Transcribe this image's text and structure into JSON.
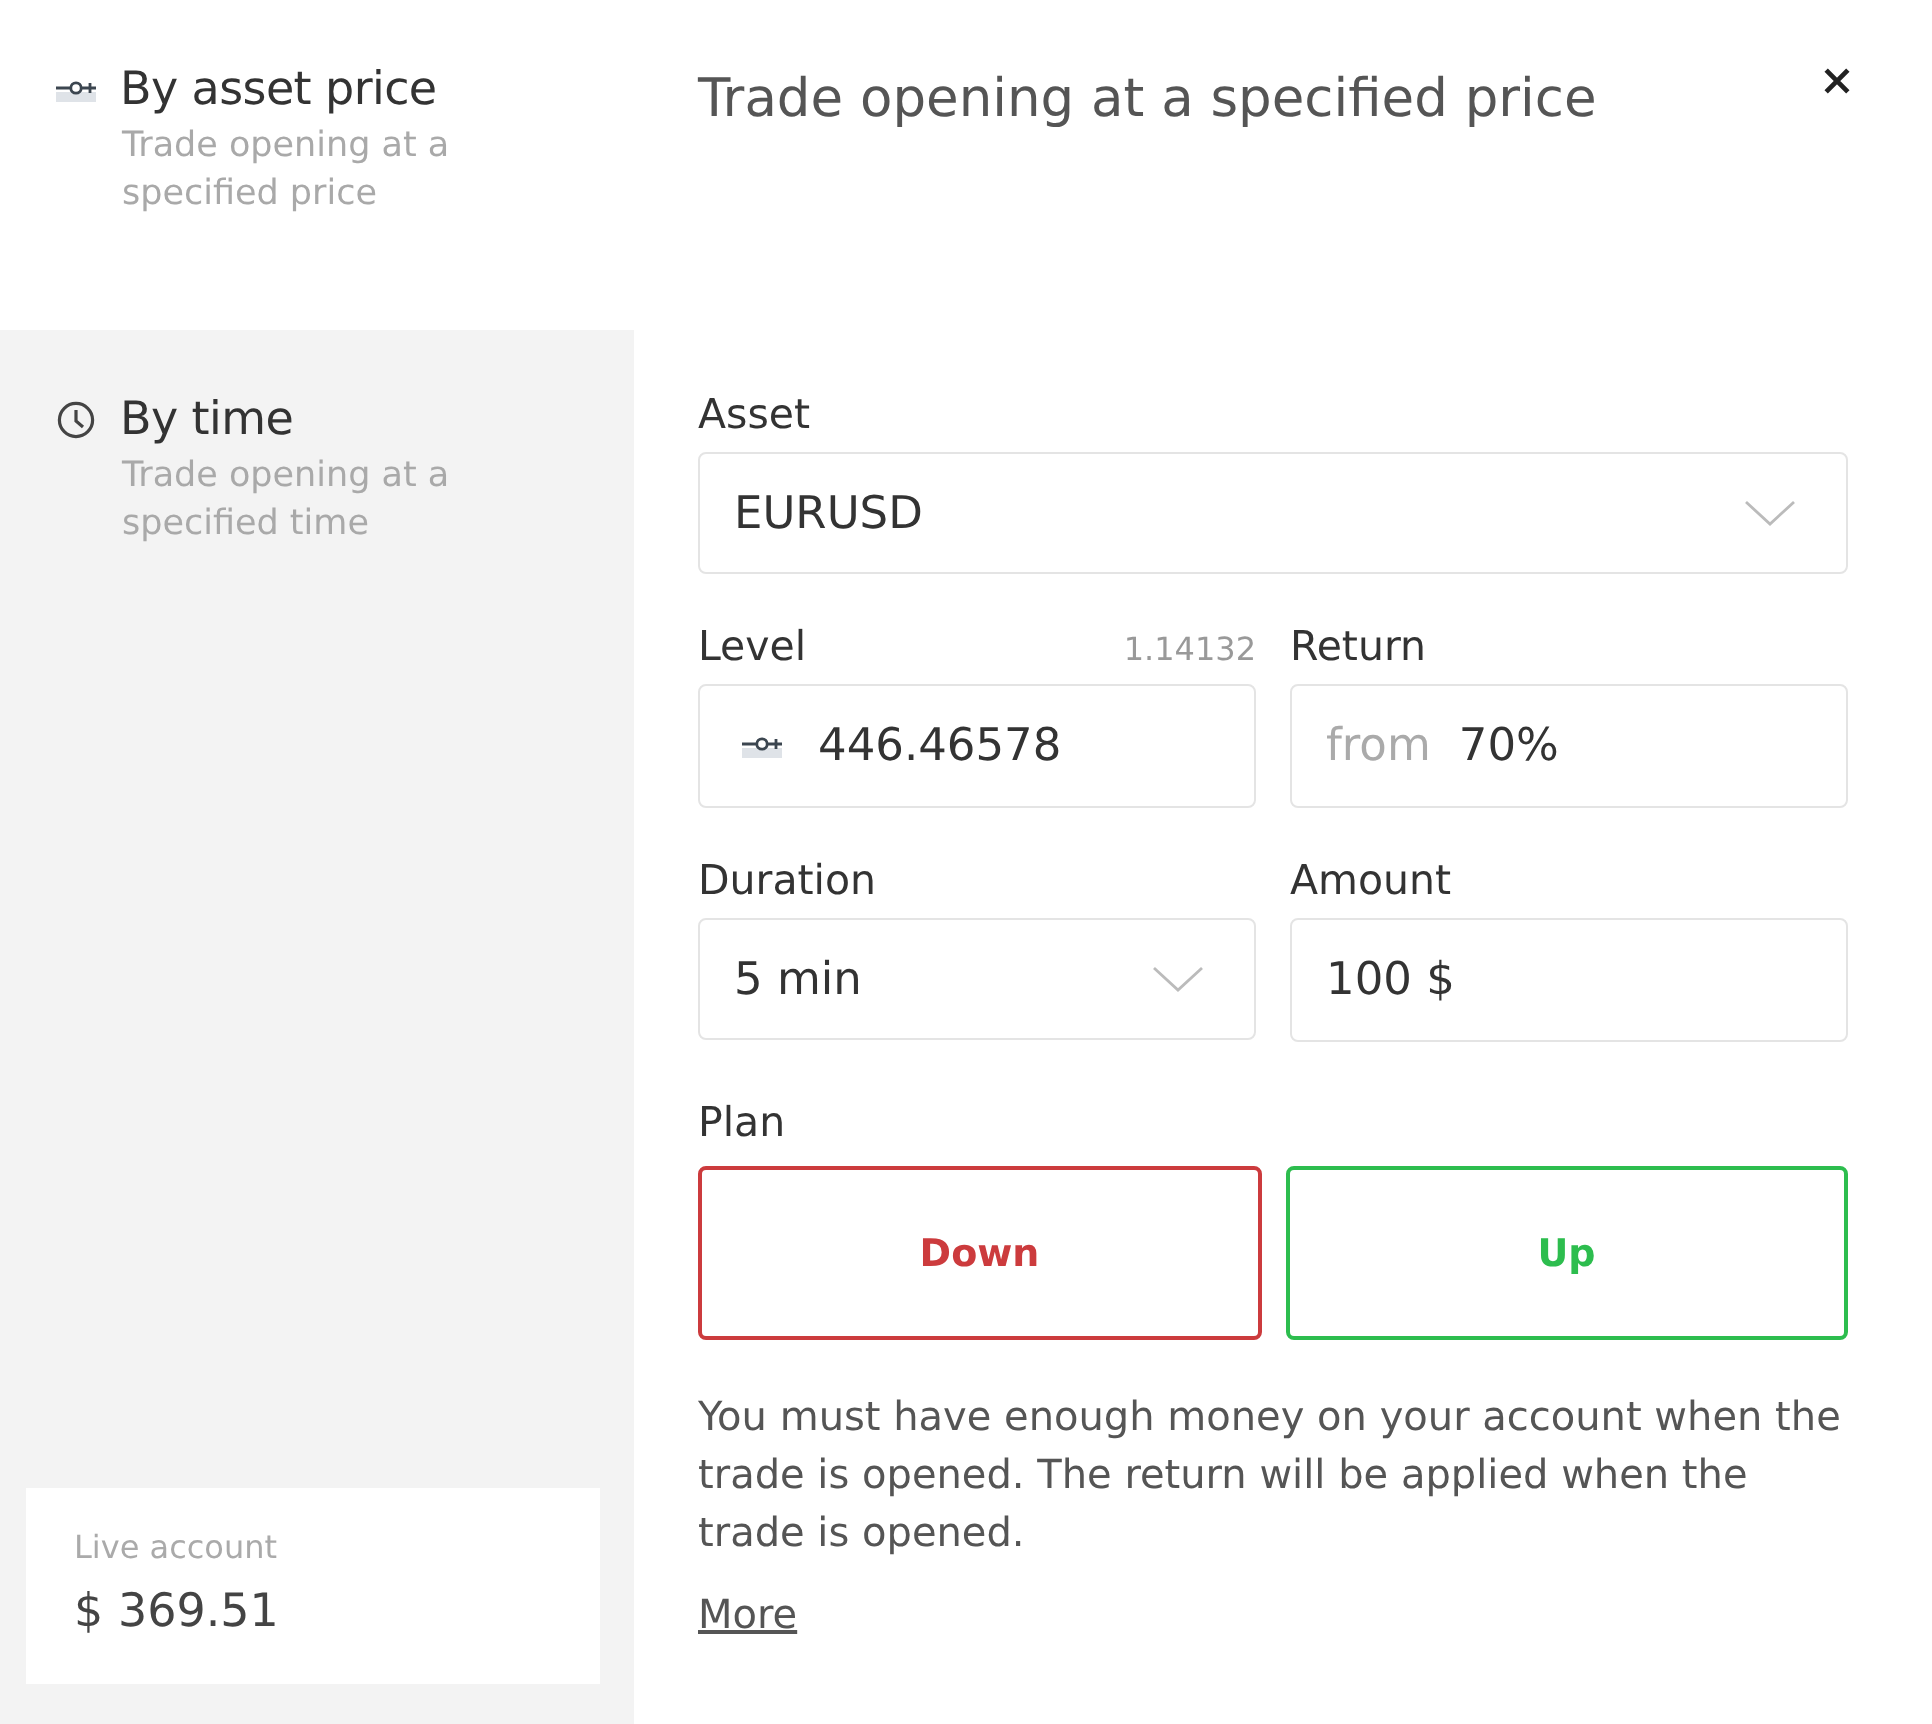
{
  "sidebar": {
    "items": [
      {
        "kind": "price",
        "title": "By asset price",
        "description": "Trade opening at a specified price",
        "selected": true
      },
      {
        "kind": "time",
        "title": "By time",
        "description": "Trade opening at a specified time",
        "selected": false
      }
    ],
    "account": {
      "label": "Live account",
      "balance": "$ 369.51"
    }
  },
  "header": {
    "title": "Trade opening at a specified price"
  },
  "form": {
    "asset": {
      "label": "Asset",
      "value": "EURUSD"
    },
    "level": {
      "label": "Level",
      "hint": "1.14132",
      "value": "446.46578"
    },
    "return": {
      "label": "Return",
      "prefix": "from",
      "value": "70%"
    },
    "duration": {
      "label": "Duration",
      "value": "5 min"
    },
    "amount": {
      "label": "Amount",
      "value": "100 $"
    }
  },
  "plan": {
    "label": "Plan",
    "buttons": [
      {
        "kind": "down",
        "label": "Down"
      },
      {
        "kind": "up",
        "label": "Up"
      }
    ]
  },
  "note": {
    "text": "You must have enough money on your account when the trade is opened. The return will be applied when the trade is opened.",
    "link": "More"
  }
}
